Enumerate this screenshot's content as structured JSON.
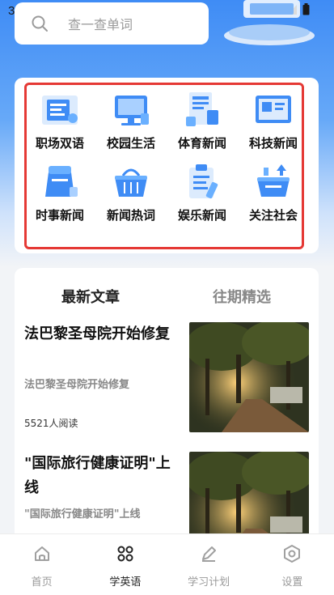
{
  "status": {
    "time": "3:34"
  },
  "search": {
    "placeholder": "查一查单词"
  },
  "categories": [
    {
      "label": "职场双语",
      "icon": "workplace-icon"
    },
    {
      "label": "校园生活",
      "icon": "campus-monitor-icon"
    },
    {
      "label": "体育新闻",
      "icon": "sports-news-icon"
    },
    {
      "label": "科技新闻",
      "icon": "tech-news-icon"
    },
    {
      "label": "时事新闻",
      "icon": "current-affairs-icon"
    },
    {
      "label": "新闻热词",
      "icon": "basket-icon"
    },
    {
      "label": "娱乐新闻",
      "icon": "clipboard-icon"
    },
    {
      "label": "关注社会",
      "icon": "society-icon"
    }
  ],
  "tabs": {
    "latest": "最新文章",
    "past": "往期精选"
  },
  "articles": [
    {
      "title": "法巴黎圣母院开始修复",
      "subtitle": "法巴黎圣母院开始修复",
      "reads": "5521人阅读"
    },
    {
      "title": "\"国际旅行健康证明\"上线",
      "subtitle": "\"国际旅行健康证明\"上线"
    }
  ],
  "tabbar": {
    "home": "首页",
    "learn": "学英语",
    "plan": "学习计划",
    "settings": "设置"
  },
  "colors": {
    "accent": "#3f8cf5",
    "highlight": "#e53935"
  }
}
